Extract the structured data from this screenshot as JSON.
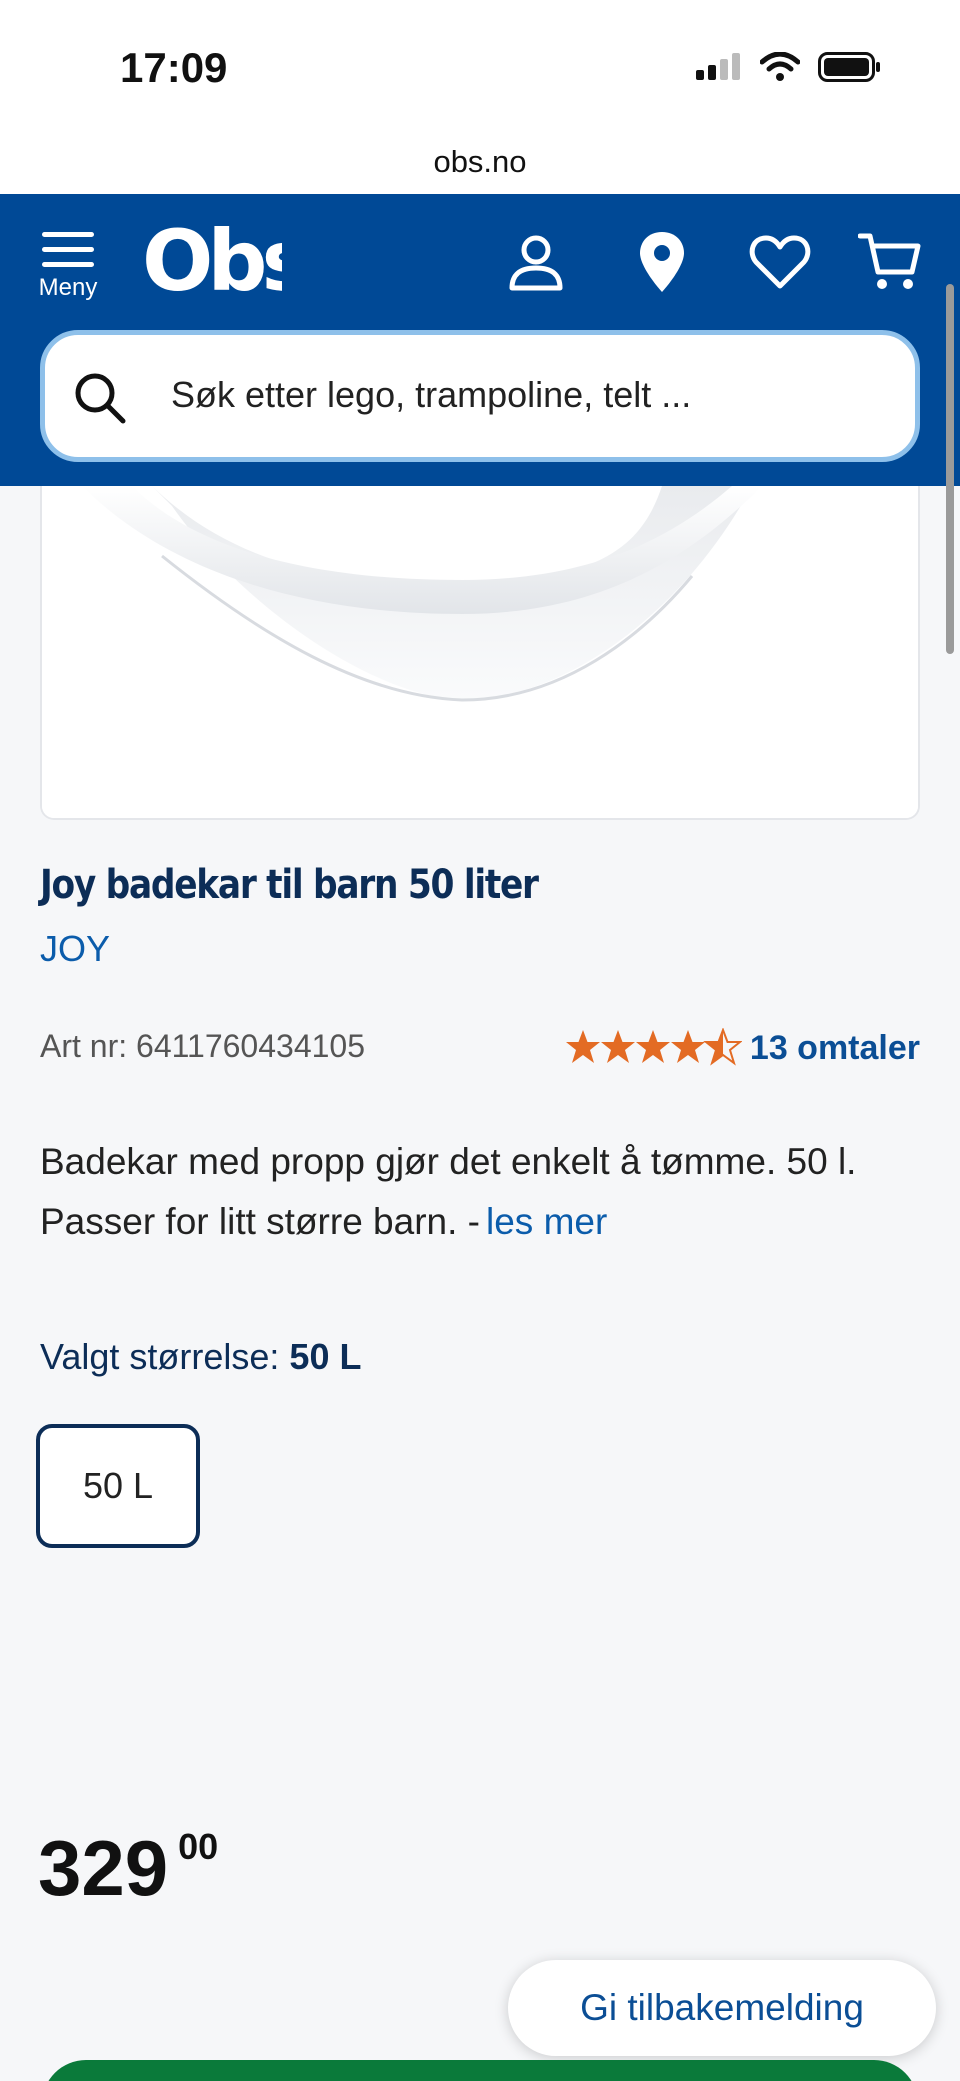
{
  "status_bar": {
    "time": "17:09",
    "icons": [
      "cellular-signal-icon",
      "wifi-icon",
      "battery-icon"
    ]
  },
  "browser": {
    "url": "obs.no"
  },
  "header": {
    "menu_label": "Meny",
    "logo_text": "Obs",
    "icons": [
      "account-icon",
      "store-location-icon",
      "favorites-heart-icon",
      "cart-icon"
    ],
    "background_color": "#004996"
  },
  "search": {
    "placeholder": "Søk etter lego, trampoline, telt ..."
  },
  "product": {
    "title": "Joy badekar til barn 50 liter",
    "brand": "JOY",
    "art_nr": "Art nr: 6411760434105",
    "rating": 4.5,
    "rating_max": 5,
    "reviews_label": "13 omtaler",
    "description": "Badekar med propp gjør det enkelt å tømme. 50 l. Passer for litt større barn. -",
    "read_more": "les mer",
    "size_label": "Valgt størrelse:",
    "selected_size": "50 L",
    "sizes": [
      "50 L"
    ],
    "price_main": "329",
    "price_decimals": "00"
  },
  "feedback_button": "Gi tilbakemelding",
  "colors": {
    "brand_blue": "#004996",
    "title_navy": "#0c2d57",
    "link_blue": "#0b5cab",
    "star_orange": "#e36b24",
    "buy_green": "#0a7a3a"
  }
}
